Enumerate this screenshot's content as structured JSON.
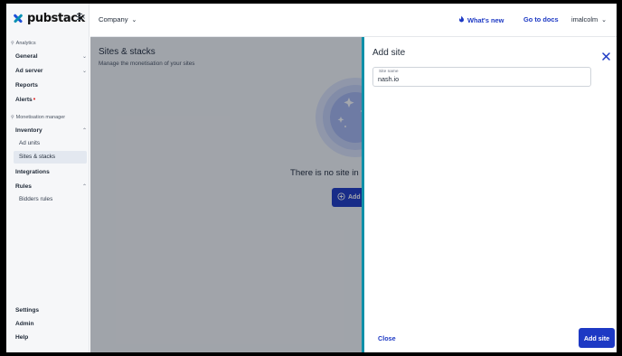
{
  "brand": {
    "name": "pubstack"
  },
  "sidebar": {
    "sections": [
      {
        "label": "Analytics"
      },
      {
        "label": "Monetisation manager"
      }
    ],
    "items": {
      "general": "General",
      "ad_server": "Ad server",
      "reports": "Reports",
      "alerts": "Alerts",
      "inventory": "Inventory",
      "ad_units": "Ad units",
      "sites_stacks": "Sites & stacks",
      "integrations": "Integrations",
      "rules": "Rules",
      "bidders_rules": "Bidders rules",
      "settings": "Settings",
      "admin": "Admin",
      "help": "Help"
    }
  },
  "topbar": {
    "company": "Company",
    "whats_new": "What's new",
    "go_to_docs": "Go to docs",
    "user": "imalcolm"
  },
  "main": {
    "title": "Sites & stacks",
    "subtitle": "Manage the monetisation of your sites",
    "empty_text": "There is no site in",
    "empty_button": "Add"
  },
  "drawer": {
    "title": "Add site",
    "field_label": "Site name",
    "field_value": "nash.io",
    "close_label": "Close",
    "submit_label": "Add site"
  },
  "colors": {
    "accent": "#1d39c4",
    "drawer_border": "#0e8fa8",
    "alert": "#dc2626"
  },
  "icons": [
    "pubstack-logo-icon",
    "collapse-menu-icon",
    "chevron-down-icon",
    "chevron-up-icon",
    "flame-icon",
    "close-icon",
    "add-site-icon",
    "analytics-icon",
    "monetisation-icon"
  ]
}
